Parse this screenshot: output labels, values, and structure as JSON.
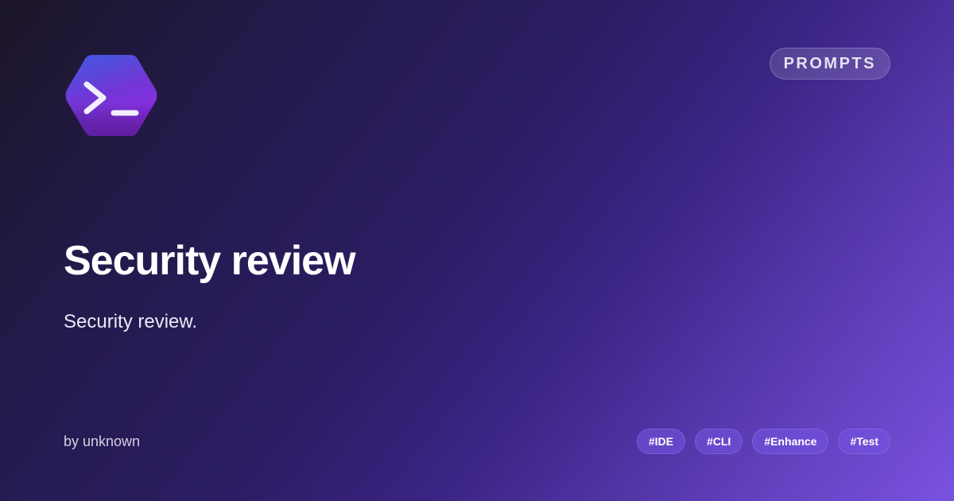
{
  "header": {
    "logo_icon": "terminal-prompt-icon",
    "category_badge": "PROMPTS"
  },
  "main": {
    "title": "Security review",
    "description": "Security review."
  },
  "footer": {
    "author": "by unknown",
    "tags": [
      "#IDE",
      "#CLI",
      "#Enhance",
      "#Test"
    ]
  },
  "colors": {
    "background_start": "#1c1628",
    "background_end": "#7a52e0",
    "logo_top": "#3e5be0",
    "logo_bottom": "#8a2be2",
    "tag_background": "#7456e4"
  }
}
